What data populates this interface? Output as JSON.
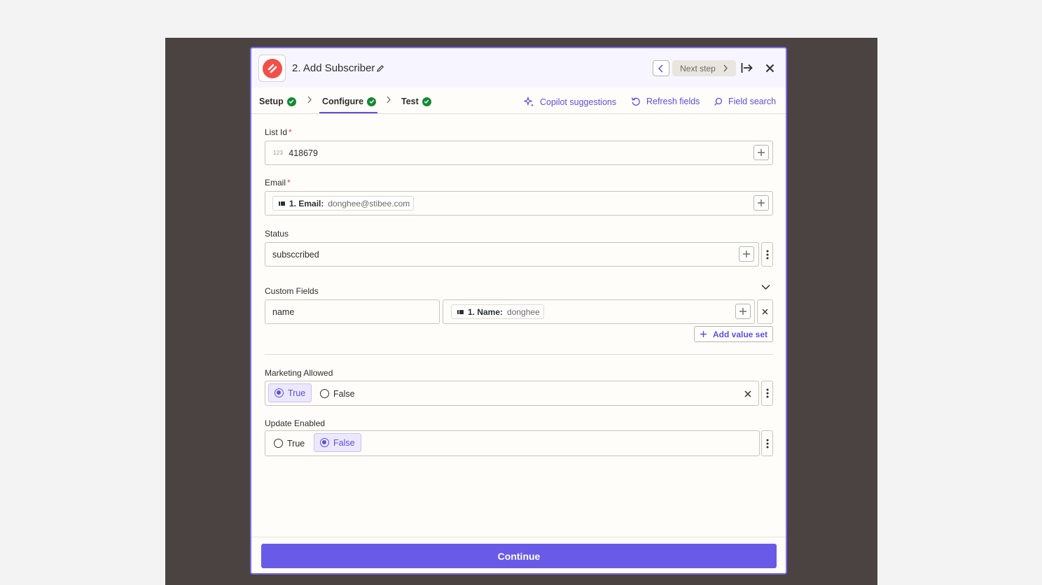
{
  "header": {
    "step_title": "2. Add Subscriber",
    "next_step_label": "Next step",
    "app_icon": "stibee-logo-icon"
  },
  "tabs": [
    {
      "label": "Setup",
      "status": "complete"
    },
    {
      "label": "Configure",
      "status": "complete",
      "active": true
    },
    {
      "label": "Test",
      "status": "complete"
    }
  ],
  "tools": {
    "copilot": "Copilot suggestions",
    "refresh": "Refresh fields",
    "field_search": "Field search"
  },
  "fields": {
    "list_id": {
      "label": "List Id",
      "required": true,
      "type_badge": "123",
      "value": "418679"
    },
    "email": {
      "label": "Email",
      "required": true,
      "pill_key": "1. Email:",
      "pill_value": "donghee@stibee.com"
    },
    "status": {
      "label": "Status",
      "value": "subsccribed"
    },
    "custom_fields": {
      "label": "Custom Fields",
      "key": "name",
      "pill_key": "1. Name:",
      "pill_value": "donghee",
      "add_value_set": "Add value set"
    },
    "marketing_allowed": {
      "label": "Marketing Allowed",
      "options": [
        "True",
        "False"
      ],
      "selected": "True"
    },
    "update_enabled": {
      "label": "Update Enabled",
      "options": [
        "True",
        "False"
      ],
      "selected": "False"
    }
  },
  "footer": {
    "continue_label": "Continue"
  },
  "colors": {
    "accent": "#695be8",
    "success": "#138a36",
    "required": "#e0473a",
    "backdrop": "#4a4342"
  }
}
